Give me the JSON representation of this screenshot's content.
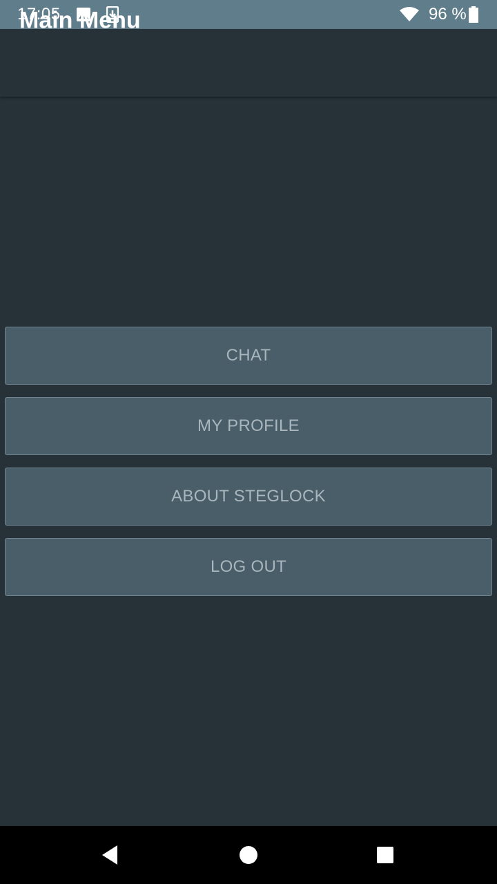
{
  "status_bar": {
    "time": "17:05",
    "battery_text": "96 %",
    "icons": [
      "image-icon",
      "download-icon",
      "wifi-icon",
      "battery-icon"
    ]
  },
  "app_bar": {
    "title": "Main Menu"
  },
  "menu": {
    "items": [
      {
        "label": "CHAT"
      },
      {
        "label": "MY PROFILE"
      },
      {
        "label": "ABOUT STEGLOCK"
      },
      {
        "label": "LOG OUT"
      }
    ]
  },
  "nav_bar": {
    "icons": [
      "back-icon",
      "home-icon",
      "recents-icon"
    ]
  },
  "colors": {
    "status_bar": "#607d8b",
    "background": "#263238",
    "button": "#4a5e69",
    "button_text": "#a9b6bd"
  }
}
